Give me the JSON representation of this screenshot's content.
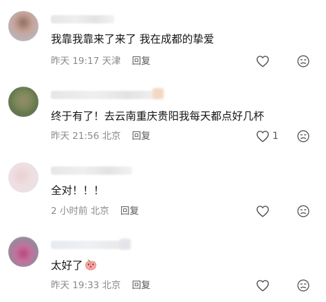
{
  "comments": [
    {
      "text": "我靠我靠来了来了 我在成都的挚爱",
      "time": "昨天 19:17",
      "location": "天津",
      "reply_label": "回复",
      "likes": ""
    },
    {
      "text": "终于有了！去云南重庆贵阳我每天都点好几杯",
      "time": "昨天 21:56",
      "location": "北京",
      "reply_label": "回复",
      "likes": "1"
    },
    {
      "text": "全对！！！",
      "time": "2 小时前",
      "location": "北京",
      "reply_label": "回复",
      "likes": ""
    },
    {
      "text": "太好了",
      "time": "昨天 19:33",
      "location": "北京",
      "reply_label": "回复",
      "likes": ""
    }
  ],
  "colors": {
    "text": "#161616",
    "meta": "#8a8a8a",
    "icon": "#555555",
    "background": "#ffffff"
  },
  "icons": [
    "heart-outline-icon",
    "dislike-face-icon",
    "peach-emoji-icon"
  ]
}
